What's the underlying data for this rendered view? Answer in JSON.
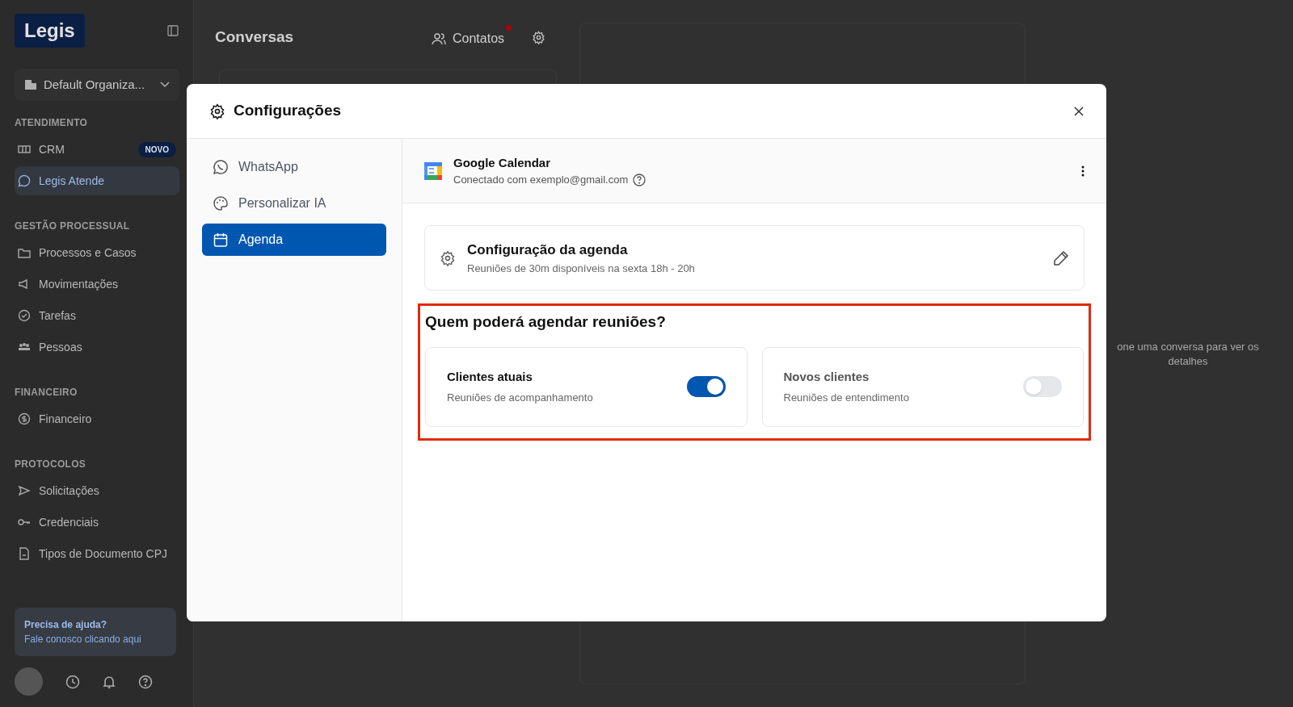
{
  "sidebar": {
    "logo": "Legis",
    "organization": "Default Organiza...",
    "sections": [
      {
        "title": "ATENDIMENTO",
        "items": [
          {
            "label": "CRM",
            "badge": "NOVO",
            "selected": false
          },
          {
            "label": "Legis Atende",
            "selected": true
          }
        ]
      },
      {
        "title": "GESTÃO PROCESSUAL",
        "items": [
          {
            "label": "Processos e Casos",
            "selected": false
          },
          {
            "label": "Movimentações",
            "selected": false
          },
          {
            "label": "Tarefas",
            "selected": false
          },
          {
            "label": "Pessoas",
            "selected": false
          }
        ]
      },
      {
        "title": "FINANCEIRO",
        "items": [
          {
            "label": "Financeiro",
            "selected": false
          }
        ]
      },
      {
        "title": "PROTOCOLOS",
        "items": [
          {
            "label": "Solicitações",
            "selected": false
          },
          {
            "label": "Credenciais",
            "selected": false
          },
          {
            "label": "Tipos de Documento CPJ",
            "selected": false
          }
        ]
      }
    ],
    "help": {
      "title": "Precisa de ajuda?",
      "link": "Fale conosco clicando aqui"
    }
  },
  "main": {
    "title": "Conversas",
    "contacts": {
      "label": "Contatos",
      "unread": true
    },
    "empty_text": "one uma conversa para ver os detalhes"
  },
  "modal": {
    "title": "Configurações",
    "nav": [
      {
        "label": "WhatsApp",
        "selected": false
      },
      {
        "label": "Personalizar IA",
        "selected": false
      },
      {
        "label": "Agenda",
        "selected": true
      }
    ],
    "integration": {
      "name": "Google Calendar",
      "status": "Conectado com exemplo@gmail.com"
    },
    "schedule": {
      "title": "Configuração da agenda",
      "subtitle": "Reuniões de 30m disponíveis na sexta 18h - 20h"
    },
    "question": "Quem poderá agendar reuniões?",
    "options": [
      {
        "title": "Clientes atuais",
        "subtitle": "Reuniões de acompanhamento",
        "on": true
      },
      {
        "title": "Novos clientes",
        "subtitle": "Reuniões de entendimento",
        "on": false
      }
    ]
  }
}
